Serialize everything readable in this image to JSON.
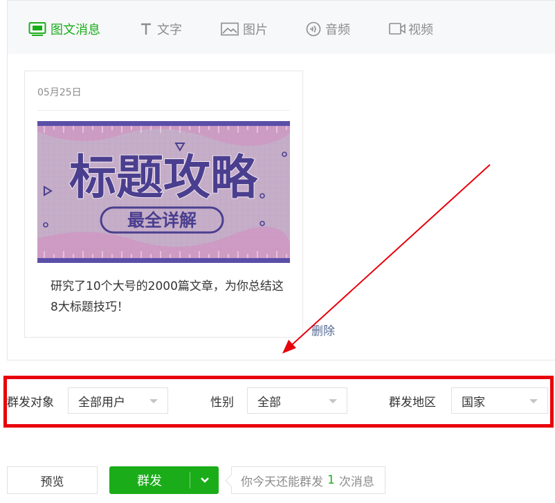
{
  "tabs": [
    {
      "label": "图文消息",
      "icon": "newsfeed-icon",
      "active": true
    },
    {
      "label": "文字",
      "icon": "text-icon",
      "active": false
    },
    {
      "label": "图片",
      "icon": "image-icon",
      "active": false
    },
    {
      "label": "音频",
      "icon": "audio-icon",
      "active": false
    },
    {
      "label": "视频",
      "icon": "video-icon",
      "active": false
    }
  ],
  "article": {
    "date": "05月25日",
    "cover": {
      "headline": "标题攻略",
      "subline": "最全详解"
    },
    "title": "研究了10个大号的2000篇文章，为你总结这8大标题技巧！",
    "delete_label": "删除"
  },
  "filters": {
    "target": {
      "label": "群发对象",
      "value": "全部用户"
    },
    "gender": {
      "label": "性别",
      "value": "全部"
    },
    "region": {
      "label": "群发地区",
      "value": "国家"
    }
  },
  "actions": {
    "preview_label": "预览",
    "send_label": "群发",
    "quota_prefix": "你今天还能群发",
    "quota_count": "1",
    "quota_suffix": "次消息"
  },
  "colors": {
    "accent": "#1aad19",
    "annotation": "#e8000b",
    "link": "#576b95"
  }
}
